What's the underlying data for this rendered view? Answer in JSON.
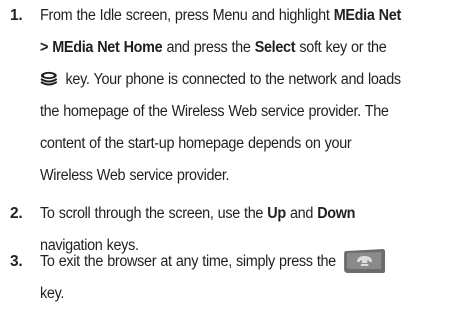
{
  "steps": [
    {
      "number": "1.",
      "line1_a": "From the Idle screen, press Menu and highlight ",
      "line1_b": "MEdia Net",
      "line2_a": "> MEdia Net Home",
      "line2_b": " and press the ",
      "line2_c": "Select",
      "line2_d": " soft key or the",
      "ok_key_icon": "ok-key-icon",
      "line3_a": " key. Your phone is connected to the network and loads",
      "line4": "the homepage of the Wireless Web service provider. The",
      "line5": "content of the start-up homepage depends on your",
      "line6": "Wireless Web service provider."
    },
    {
      "number": "2.",
      "line1_a": "To scroll through the screen, use the ",
      "line1_b": "Up",
      "line1_c": " and ",
      "line1_d": "Down",
      "line2": "navigation keys."
    },
    {
      "number": "3.",
      "line1_a": "To exit the browser at any time, simply press the",
      "end_key_icon": "end-key-icon",
      "line2": "key."
    }
  ],
  "colors": {
    "text": "#231f20",
    "end_key_body": "#6b6b6b",
    "end_key_face": "#dcdcdc"
  }
}
